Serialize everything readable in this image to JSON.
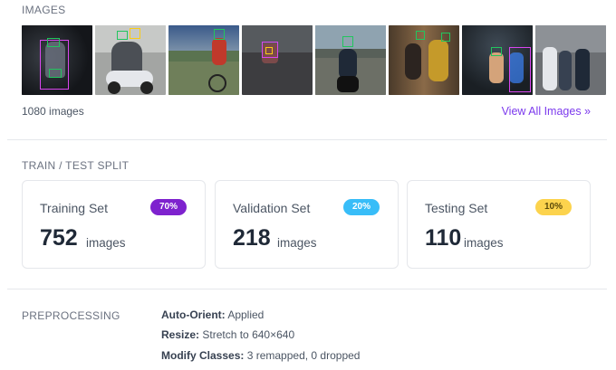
{
  "images_section": {
    "label": "IMAGES",
    "count_text": "1080 images",
    "view_all": "View All Images »",
    "thumbnails": [
      {
        "name": "thumb-1",
        "bg": "#1b1d21",
        "scene": "night street"
      },
      {
        "name": "thumb-2",
        "bg": "#9a9c9a",
        "scene": "scooter riders"
      },
      {
        "name": "thumb-3",
        "bg": "#5a7350",
        "scene": "cyclist road"
      },
      {
        "name": "thumb-4",
        "bg": "#3d3d40",
        "scene": "dark road"
      },
      {
        "name": "thumb-5",
        "bg": "#586059",
        "scene": "motorbike"
      },
      {
        "name": "thumb-6",
        "bg": "#5b4a38",
        "scene": "group selfie"
      },
      {
        "name": "thumb-7",
        "bg": "#2a3138",
        "scene": "night riders"
      },
      {
        "name": "thumb-8",
        "bg": "#6c6f73",
        "scene": "street people"
      }
    ]
  },
  "split_section": {
    "label": "TRAIN / TEST SPLIT",
    "cards": [
      {
        "title": "Training Set",
        "badge": "70%",
        "count": "752",
        "unit": "images",
        "badge_color": "#7e22ce",
        "badge_text_color": "#ffffff"
      },
      {
        "title": "Validation Set",
        "badge": "20%",
        "count": "218",
        "unit": "images",
        "badge_color": "#38bdf8",
        "badge_text_color": "#ffffff"
      },
      {
        "title": "Testing Set",
        "badge": "10%",
        "count": "110",
        "unit": "images",
        "badge_color": "#fcd34d",
        "badge_text_color": "#5b4a0a"
      }
    ]
  },
  "preprocessing": {
    "label": "PREPROCESSING",
    "rows": [
      {
        "key": "Auto-Orient:",
        "value": "Applied"
      },
      {
        "key": "Resize:",
        "value": "Stretch to 640×640"
      },
      {
        "key": "Modify Classes:",
        "value": "3 remapped, 0 dropped"
      }
    ]
  }
}
